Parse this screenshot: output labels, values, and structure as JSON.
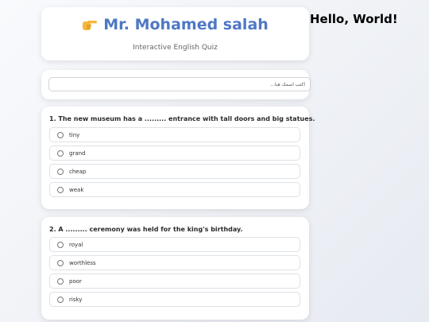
{
  "greeting": "Hello, World!",
  "header": {
    "icon": "pointing-hand-icon",
    "title": "Mr. Mohamed salah",
    "subtitle": "Interactive English Quiz",
    "title_color": "#4f78c4"
  },
  "name_field": {
    "placeholder": "اكتب اسمك هنا...",
    "value": ""
  },
  "questions": [
    {
      "text": "1. The new museum has a ......... entrance with tall doors and big statues.",
      "options": [
        "tiny",
        "grand",
        "cheap",
        "weak"
      ]
    },
    {
      "text": "2. A ......... ceremony was held for the king's birthday.",
      "options": [
        "royal",
        "worthless",
        "poor",
        "risky"
      ]
    }
  ]
}
